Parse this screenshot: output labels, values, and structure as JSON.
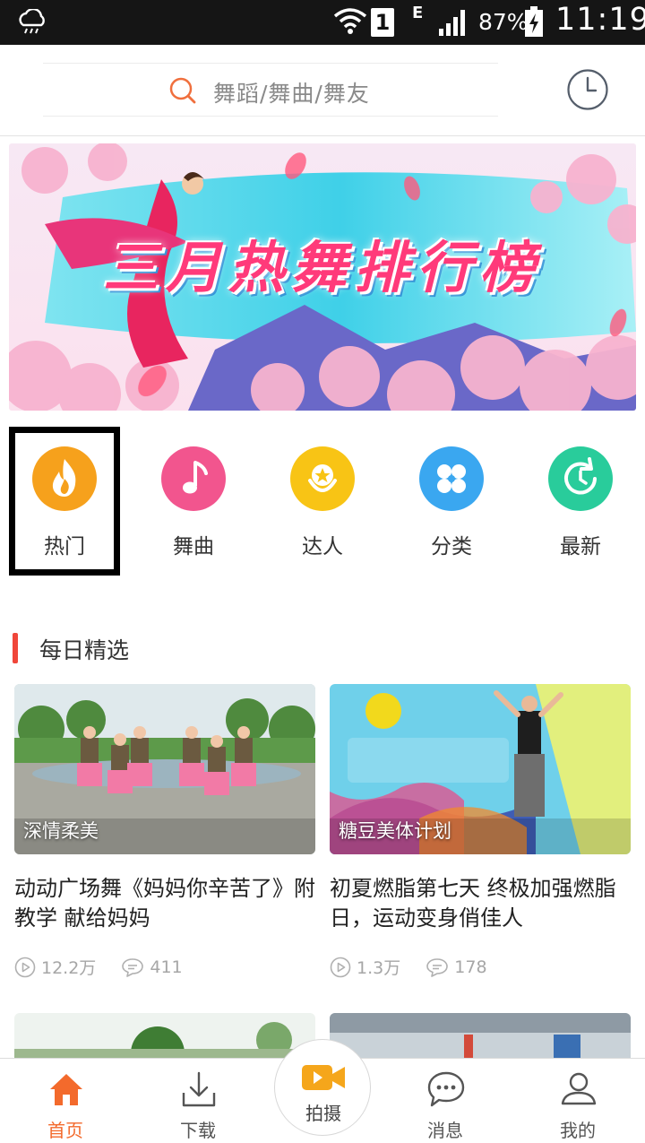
{
  "status_bar": {
    "sim_slot": "1",
    "network_type": "E",
    "battery_percent": "87%",
    "time": "11:19"
  },
  "search": {
    "placeholder": "舞蹈/舞曲/舞友"
  },
  "banner": {
    "title": "三月热舞排行榜"
  },
  "categories": [
    {
      "label": "热门",
      "icon": "flame-icon",
      "color": "#f6a11c"
    },
    {
      "label": "舞曲",
      "icon": "music-note-icon",
      "color": "#f2558e"
    },
    {
      "label": "达人",
      "icon": "star-badge-icon",
      "color": "#f8c415"
    },
    {
      "label": "分类",
      "icon": "clover-grid-icon",
      "color": "#3aa7f0"
    },
    {
      "label": "最新",
      "icon": "refresh-clock-icon",
      "color": "#29cc9b"
    }
  ],
  "section": {
    "title": "每日精选"
  },
  "videos": [
    {
      "tag": "深情柔美",
      "title": "动动广场舞《妈妈你辛苦了》附教学 献给妈妈",
      "plays": "12.2万",
      "comments": "411"
    },
    {
      "tag": "糖豆美体计划",
      "title": "初夏燃脂第七天 终极加强燃脂日，运动变身俏佳人",
      "plays": "1.3万",
      "comments": "178"
    }
  ],
  "bottom_nav": {
    "home": "首页",
    "download": "下载",
    "shoot": "拍摄",
    "messages": "消息",
    "profile": "我的"
  },
  "colors": {
    "accent": "#f36a2c",
    "section_bar": "#f0463a",
    "status_bar_bg": "#151515"
  }
}
